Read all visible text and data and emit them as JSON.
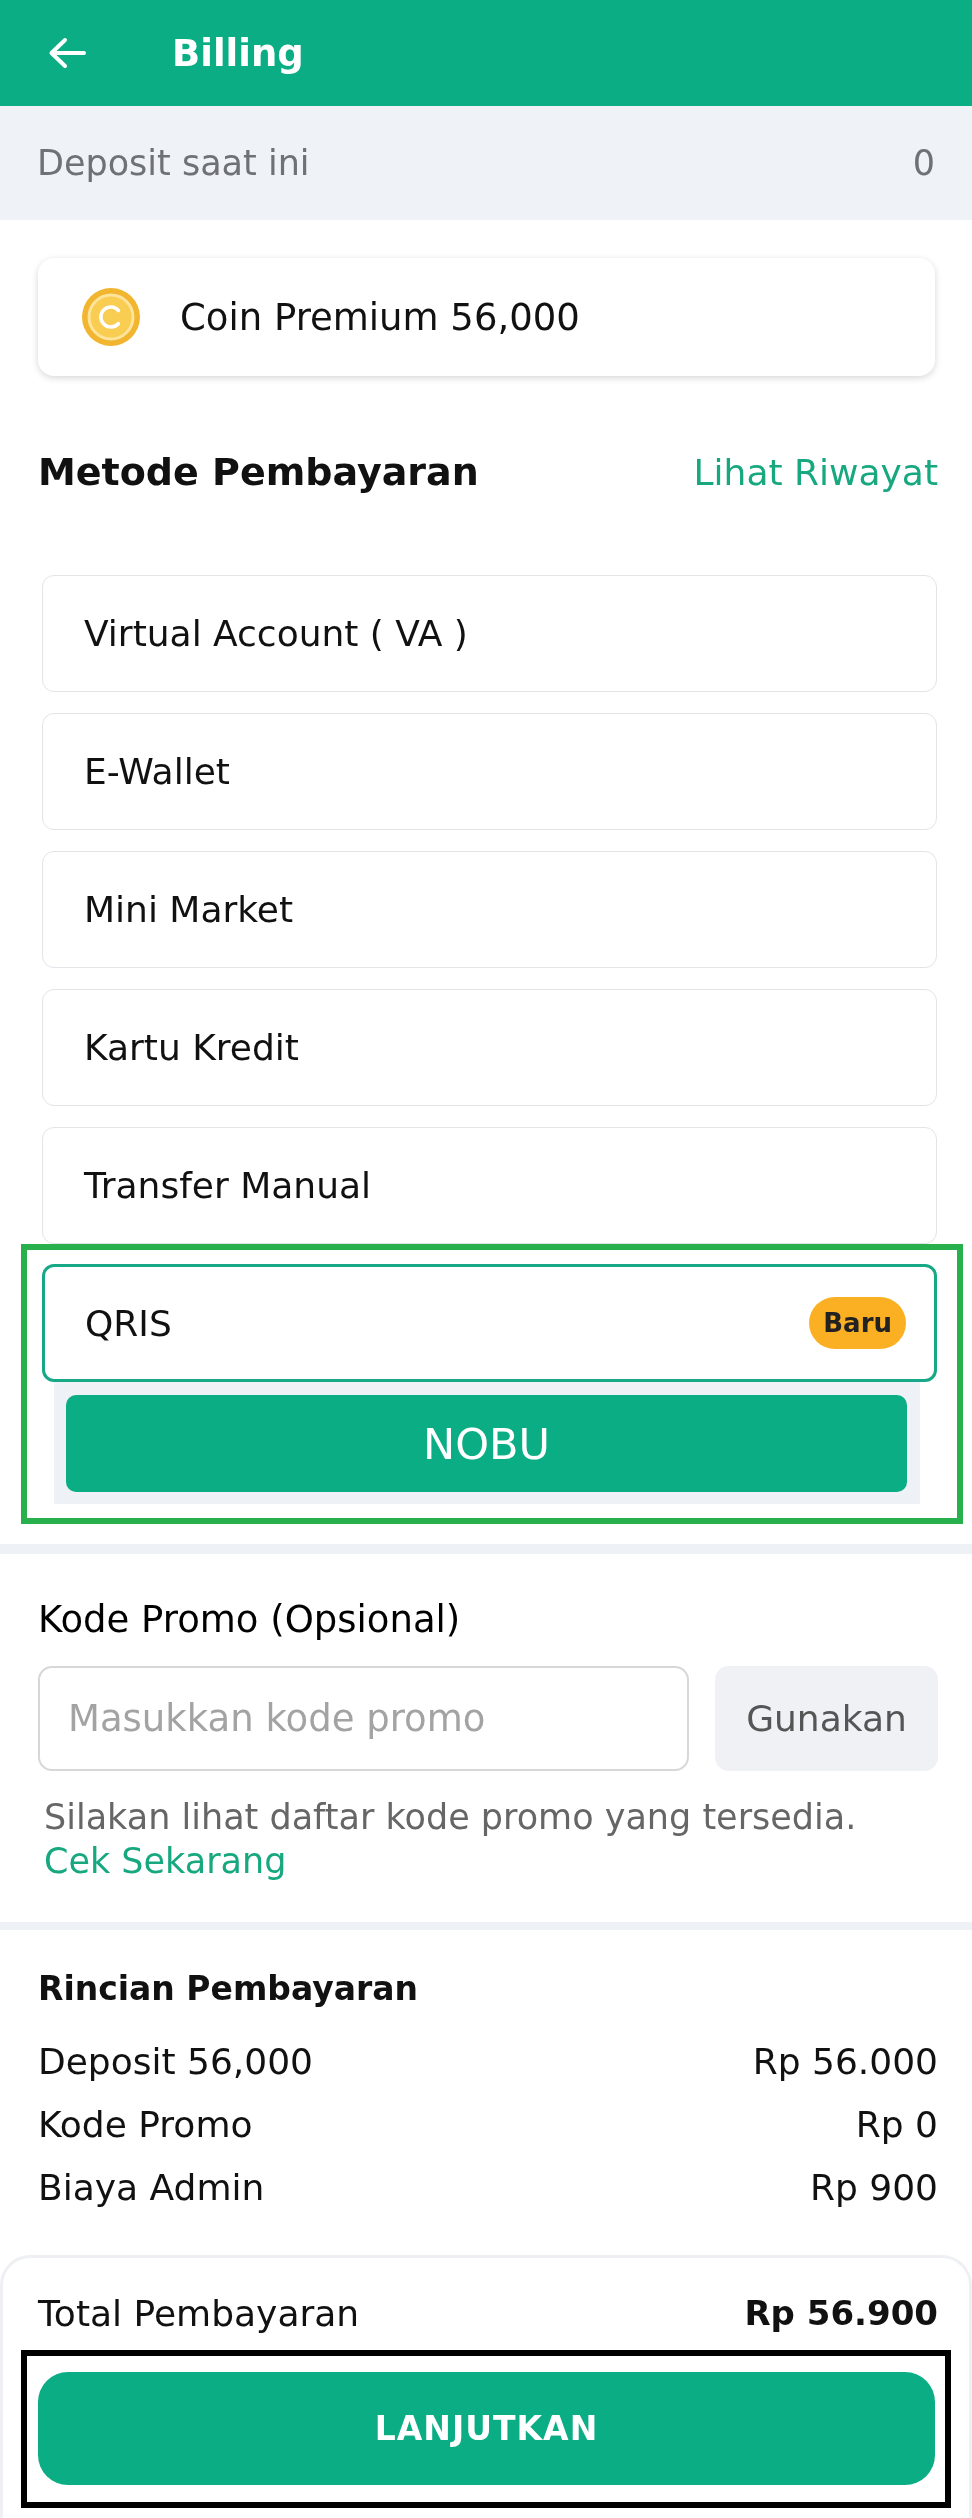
{
  "header": {
    "title": "Billing"
  },
  "deposit": {
    "label": "Deposit saat ini",
    "value": "0"
  },
  "product": {
    "name": "Coin Premium 56,000"
  },
  "payment_methods": {
    "title": "Metode Pembayaran",
    "history_link": "Lihat Riwayat",
    "items": [
      {
        "label": "Virtual Account ( VA )",
        "selected": false,
        "highlighted": false
      },
      {
        "label": "E-Wallet",
        "selected": false,
        "highlighted": false
      },
      {
        "label": "Mini Market",
        "selected": false,
        "highlighted": false
      },
      {
        "label": "Kartu Kredit",
        "selected": false,
        "highlighted": false
      },
      {
        "label": "Transfer Manual",
        "selected": false,
        "highlighted": false
      },
      {
        "label": "QRIS",
        "selected": true,
        "highlighted": true,
        "badge": "Baru",
        "options": [
          {
            "label": "NOBU"
          }
        ]
      }
    ]
  },
  "promo": {
    "title": "Kode Promo (Opsional)",
    "placeholder": "Masukkan kode promo",
    "apply_button": "Gunakan",
    "hint": "Silakan lihat daftar kode promo yang tersedia.",
    "link": "Cek Sekarang"
  },
  "breakdown": {
    "title": "Rincian Pembayaran",
    "rows": [
      {
        "label": "Deposit 56,000",
        "value": "Rp 56.000"
      },
      {
        "label": "Kode Promo",
        "value": "Rp 0"
      },
      {
        "label": "Biaya Admin",
        "value": "Rp 900"
      }
    ]
  },
  "total": {
    "label": "Total Pembayaran",
    "value": "Rp 56.900"
  },
  "submit": {
    "label": "LANJUTKAN",
    "highlighted": true
  }
}
